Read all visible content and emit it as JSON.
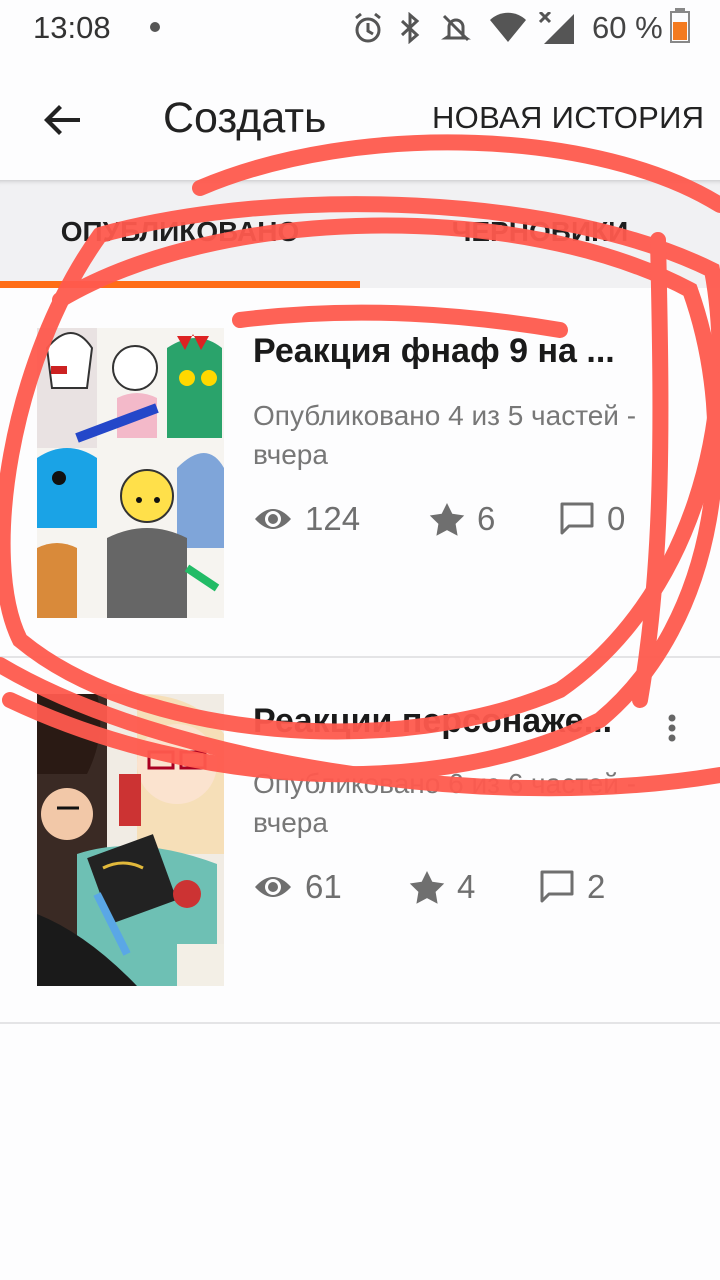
{
  "status": {
    "time": "13:08",
    "battery": "60 %"
  },
  "appbar": {
    "title": "Создать",
    "new_story": "НОВАЯ ИСТОРИЯ"
  },
  "tabs": [
    {
      "label": "ОПУБЛИКОВАНО",
      "active": true
    },
    {
      "label": "ЧЕРНОВИКИ",
      "active": false
    }
  ],
  "stories": [
    {
      "title": "Реакция фнаф 9 на ...",
      "meta": "Опубликовано 4 из 5 частей - вчера",
      "views": "124",
      "votes": "6",
      "comments": "0"
    },
    {
      "title": "Реакции персонаже...",
      "meta": "Опубликовано 6 из 6 частей - вчера",
      "views": "61",
      "votes": "4",
      "comments": "2"
    }
  ],
  "colors": {
    "accent": "#ff6d17",
    "annotation": "#ff5a4e"
  }
}
